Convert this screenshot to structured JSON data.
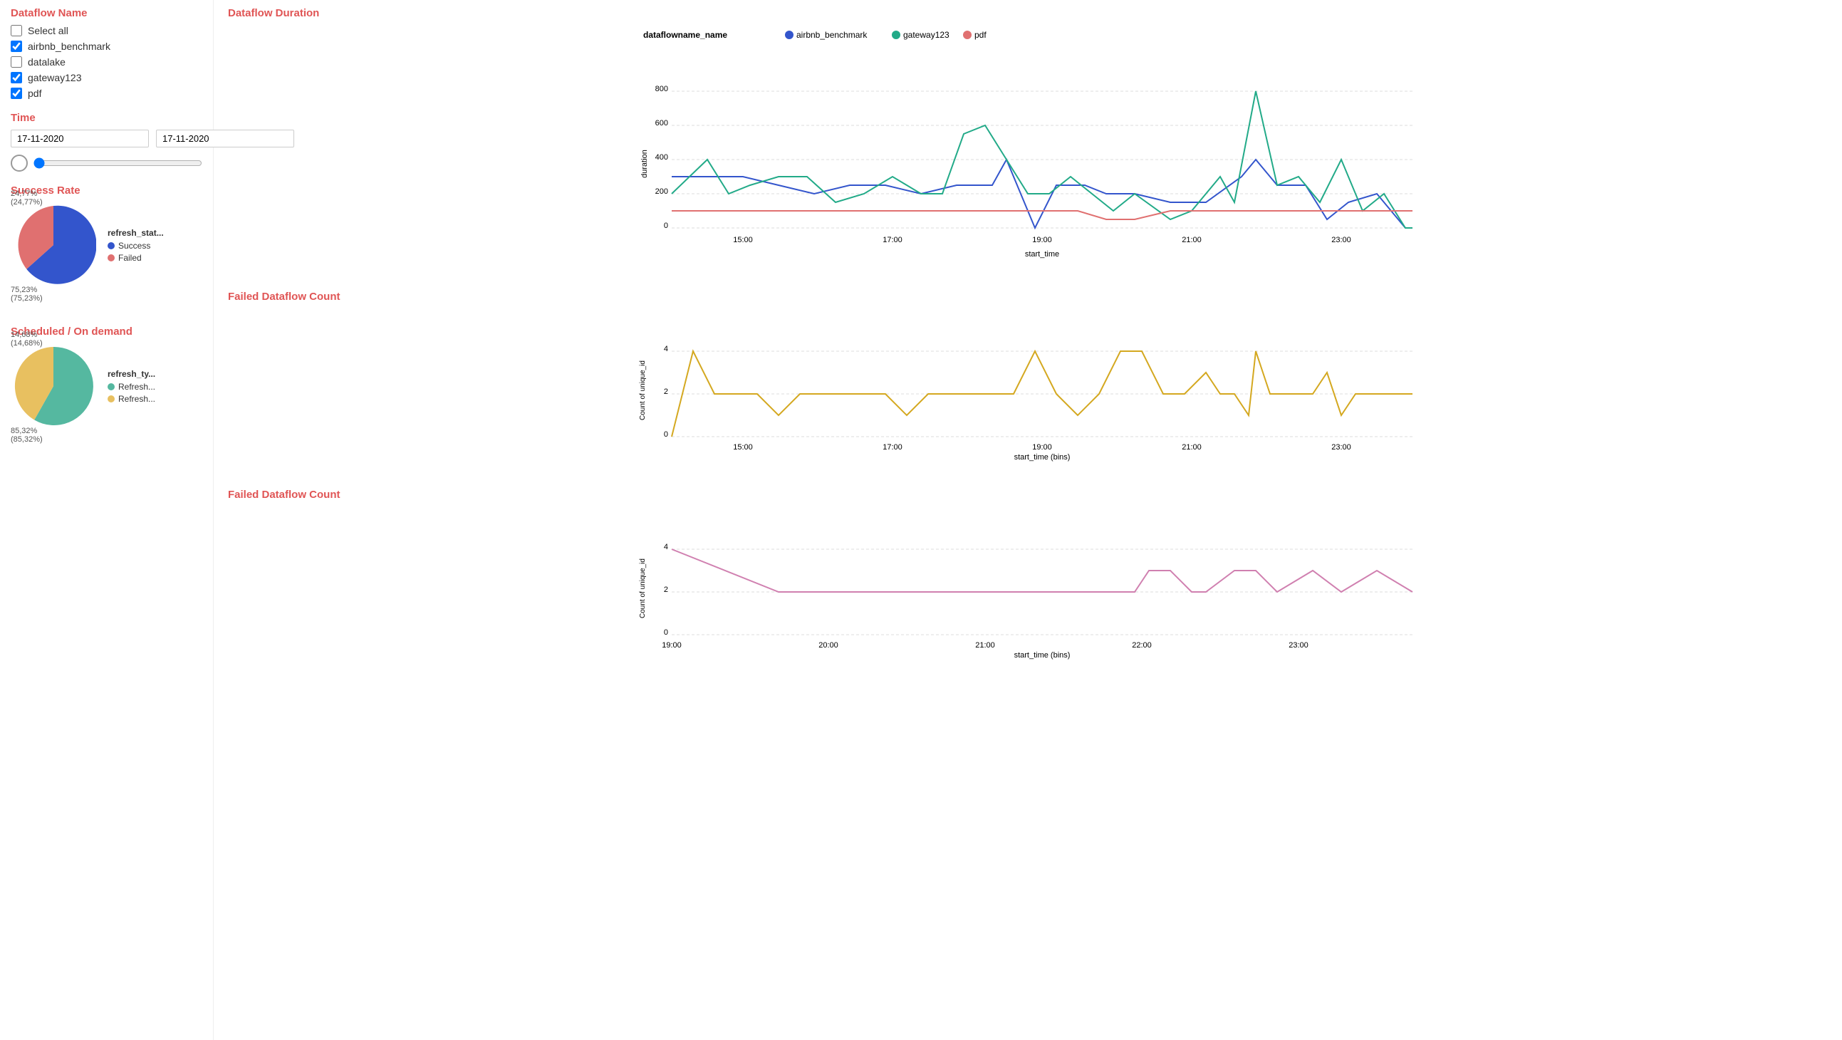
{
  "sidebar": {
    "dataflow_section_title": "Dataflow Name",
    "select_all_label": "Select all",
    "checkboxes": [
      {
        "label": "airbnb_benchmark",
        "checked": true,
        "name": "airbnb_benchmark"
      },
      {
        "label": "datalake",
        "checked": false,
        "name": "datalake"
      },
      {
        "label": "gateway123",
        "checked": true,
        "name": "gateway123"
      },
      {
        "label": "pdf",
        "checked": true,
        "name": "pdf"
      }
    ],
    "time_title": "Time",
    "date_from": "17-11-2020",
    "date_to": "17-11-2020"
  },
  "success_rate": {
    "title": "Success Rate",
    "legend_title": "refresh_stat...",
    "success_label": "Success",
    "failed_label": "Failed",
    "success_pct": 75.23,
    "failed_pct": 24.77,
    "success_label_text": "75,23%\n(75,23%)",
    "failed_label_text": "24,77%\n(24,77%)",
    "colors": {
      "success": "#3355cc",
      "failed": "#e07070"
    }
  },
  "scheduled": {
    "title": "Scheduled / On demand",
    "legend_title": "refresh_ty...",
    "refresh1_label": "Refresh...",
    "refresh2_label": "Refresh...",
    "pct1": 85.32,
    "pct2": 14.68,
    "pct1_text": "85,32%\n(85,32%)",
    "pct2_text": "14,68%\n(14,68%)",
    "colors": {
      "scheduled": "#55b8a0",
      "ondemand": "#e8c060"
    }
  },
  "duration_chart": {
    "title": "Dataflow Duration",
    "legend_label": "dataflowname_name",
    "legend_items": [
      {
        "label": "airbnb_benchmark",
        "color": "#3355cc"
      },
      {
        "label": "gateway123",
        "color": "#22aa88"
      },
      {
        "label": "pdf",
        "color": "#e07070"
      }
    ],
    "y_label": "duration",
    "x_label": "start_time",
    "x_ticks": [
      "15:00",
      "17:00",
      "19:00",
      "21:00",
      "23:00"
    ],
    "y_ticks": [
      "0",
      "200",
      "400",
      "600",
      "800"
    ]
  },
  "failed_count_chart1": {
    "title": "Failed Dataflow Count",
    "y_label": "Count of unique_id",
    "x_label": "start_time (bins)",
    "x_ticks": [
      "15:00",
      "17:00",
      "19:00",
      "21:00",
      "23:00"
    ],
    "y_ticks": [
      "0",
      "2",
      "4"
    ],
    "color": "#d4a820"
  },
  "failed_count_chart2": {
    "title": "Failed Dataflow Count",
    "y_label": "Count of unique_id",
    "x_label": "start_time (bins)",
    "x_ticks": [
      "19:00",
      "20:00",
      "21:00",
      "22:00",
      "23:00"
    ],
    "y_ticks": [
      "0",
      "2",
      "4"
    ],
    "color": "#d080b0"
  }
}
